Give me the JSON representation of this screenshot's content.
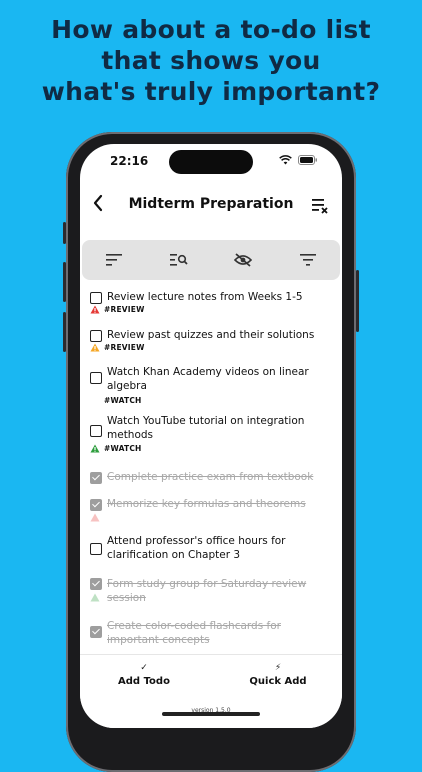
{
  "headline": [
    "How about a to-do list",
    "that shows you",
    "what's truly important?"
  ],
  "status": {
    "time": "22:16"
  },
  "nav": {
    "title": "Midterm Preparation"
  },
  "todos": [
    {
      "text": "Review lecture notes from Weeks 1-5",
      "tag": "#REVIEW",
      "priority": "high",
      "done": false
    },
    {
      "text": "Review past quizzes and their solutions",
      "tag": "#REVIEW",
      "priority": "medium",
      "done": false
    },
    {
      "text": "Watch Khan Academy videos on linear algebra",
      "tag": "#WATCH",
      "priority": "none",
      "done": false
    },
    {
      "text": "Watch YouTube tutorial on integration methods",
      "tag": "#WATCH",
      "priority": "low",
      "done": false
    },
    {
      "text": "Complete practice exam from textbook",
      "tag": "",
      "priority": "none",
      "done": true
    },
    {
      "text": "Memorize key formulas and theorems",
      "tag": "",
      "priority": "high",
      "done": true
    },
    {
      "text": "Attend professor's office hours for clarification on Chapter 3",
      "tag": "",
      "priority": "none",
      "done": false
    },
    {
      "text": "Form study group for Saturday review session",
      "tag": "",
      "priority": "low",
      "done": true
    },
    {
      "text": "Create color-coded flashcards for important concepts",
      "tag": "",
      "priority": "none",
      "done": true
    }
  ],
  "bottom": {
    "add_todo": "Add Todo",
    "add_todo_icon": "✓",
    "quick_add": "Quick Add",
    "quick_add_icon": "⚡",
    "version": "version 1.5.0"
  },
  "colors": {
    "background": "#1ab7f2",
    "high": "#e53935",
    "medium": "#f5a623",
    "low": "#2e9e3e"
  }
}
